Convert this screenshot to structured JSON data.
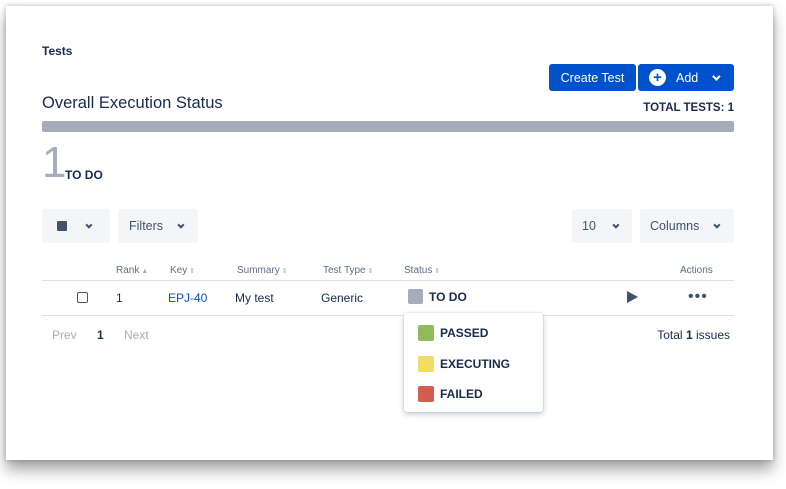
{
  "panel": {
    "section_title": "Tests",
    "create_button": "Create Test",
    "add_button": "Add"
  },
  "summary": {
    "title": "Overall Execution Status",
    "total_label": "TOTAL TESTS: 1",
    "count": "1",
    "count_label": "TO DO",
    "progress_todo_fraction": 1.0
  },
  "toolbar": {
    "filters_label": "Filters",
    "page_size": "10",
    "columns_label": "Columns"
  },
  "table": {
    "headers": {
      "rank": "Rank",
      "key": "Key",
      "summary": "Summary",
      "test_type": "Test Type",
      "status": "Status",
      "actions": "Actions"
    },
    "rows": [
      {
        "rank": "1",
        "key": "EPJ-40",
        "summary": "My test",
        "test_type": "Generic",
        "status": "TO DO"
      }
    ]
  },
  "pagination": {
    "prev": "Prev",
    "current": "1",
    "next": "Next",
    "total_prefix": "Total",
    "total_count": "1",
    "total_suffix": "issues"
  },
  "status_dropdown": {
    "options": [
      {
        "label": "PASSED",
        "color": "#8fbc5a"
      },
      {
        "label": "EXECUTING",
        "color": "#f1dd62"
      },
      {
        "label": "FAILED",
        "color": "#d45d52"
      }
    ]
  },
  "colors": {
    "primary": "#0052cc",
    "todo": "#a5adba",
    "passed": "#8fbc5a",
    "executing": "#f1dd62",
    "failed": "#d45d52"
  }
}
